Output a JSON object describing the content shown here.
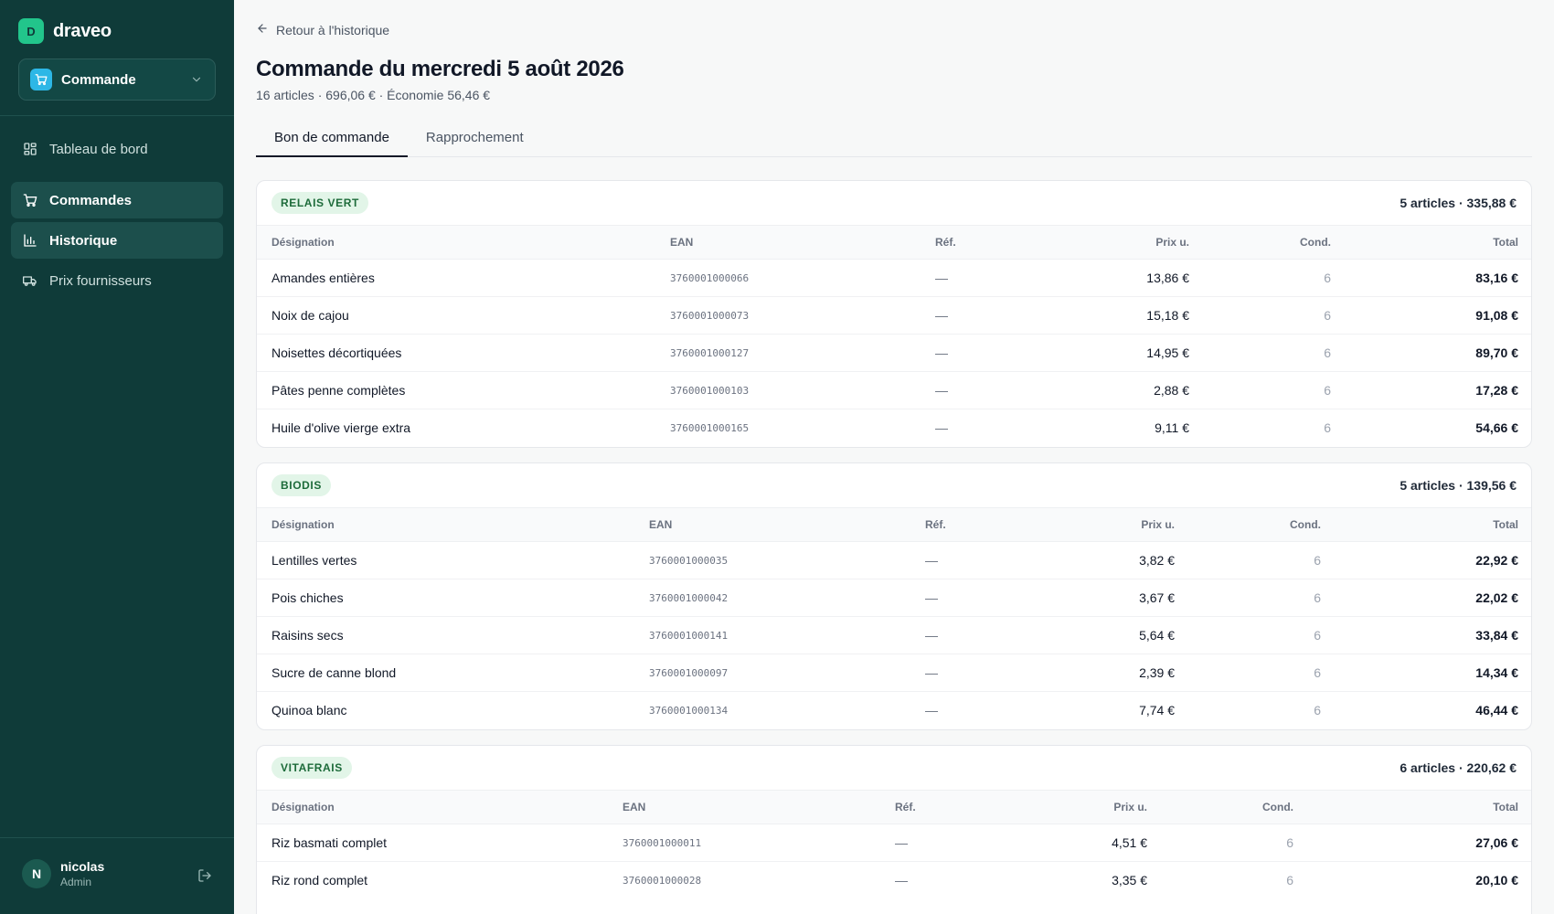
{
  "sidebar": {
    "brand": {
      "mark": "D",
      "name": "draveo"
    },
    "context": {
      "label": "Commande"
    },
    "nav": [
      {
        "label": "Tableau de bord",
        "icon": "dashboard-icon",
        "active": false
      },
      {
        "label": "Commandes",
        "icon": "cart-icon",
        "active": true
      },
      {
        "label": "Historique",
        "icon": "bar-chart-icon",
        "active": true
      },
      {
        "label": "Prix fournisseurs",
        "icon": "truck-icon",
        "active": false
      }
    ],
    "user": {
      "initial": "N",
      "name": "nicolas",
      "role": "Admin"
    }
  },
  "header": {
    "back_label": "Retour à l'historique",
    "title": "Commande du mercredi 5 août 2026",
    "subtitle": "16 articles · 696,06 € · Économie 56,46 €"
  },
  "tabs": [
    {
      "label": "Bon de commande",
      "active": true
    },
    {
      "label": "Rapprochement",
      "active": false
    }
  ],
  "columns": {
    "designation": "Désignation",
    "ean": "EAN",
    "ref": "Réf.",
    "price": "Prix u.",
    "cond": "Cond.",
    "total": "Total"
  },
  "suppliers": [
    {
      "name": "RELAIS VERT",
      "summary": "5 articles · 335,88 €",
      "rows": [
        {
          "designation": "Amandes entières",
          "ean": "3760001000066",
          "ref": "—",
          "price": "13,86 €",
          "cond": "6",
          "total": "83,16 €"
        },
        {
          "designation": "Noix de cajou",
          "ean": "3760001000073",
          "ref": "—",
          "price": "15,18 €",
          "cond": "6",
          "total": "91,08 €"
        },
        {
          "designation": "Noisettes décortiquées",
          "ean": "3760001000127",
          "ref": "—",
          "price": "14,95 €",
          "cond": "6",
          "total": "89,70 €"
        },
        {
          "designation": "Pâtes penne complètes",
          "ean": "3760001000103",
          "ref": "—",
          "price": "2,88 €",
          "cond": "6",
          "total": "17,28 €"
        },
        {
          "designation": "Huile d'olive vierge extra",
          "ean": "3760001000165",
          "ref": "—",
          "price": "9,11 €",
          "cond": "6",
          "total": "54,66 €"
        }
      ]
    },
    {
      "name": "BIODIS",
      "summary": "5 articles · 139,56 €",
      "rows": [
        {
          "designation": "Lentilles vertes",
          "ean": "3760001000035",
          "ref": "—",
          "price": "3,82 €",
          "cond": "6",
          "total": "22,92 €"
        },
        {
          "designation": "Pois chiches",
          "ean": "3760001000042",
          "ref": "—",
          "price": "3,67 €",
          "cond": "6",
          "total": "22,02 €"
        },
        {
          "designation": "Raisins secs",
          "ean": "3760001000141",
          "ref": "—",
          "price": "5,64 €",
          "cond": "6",
          "total": "33,84 €"
        },
        {
          "designation": "Sucre de canne blond",
          "ean": "3760001000097",
          "ref": "—",
          "price": "2,39 €",
          "cond": "6",
          "total": "14,34 €"
        },
        {
          "designation": "Quinoa blanc",
          "ean": "3760001000134",
          "ref": "—",
          "price": "7,74 €",
          "cond": "6",
          "total": "46,44 €"
        }
      ]
    },
    {
      "name": "VITAFRAIS",
      "summary": "6 articles · 220,62 €",
      "rows": [
        {
          "designation": "Riz basmati complet",
          "ean": "3760001000011",
          "ref": "—",
          "price": "4,51 €",
          "cond": "6",
          "total": "27,06 €"
        },
        {
          "designation": "Riz rond complet",
          "ean": "3760001000028",
          "ref": "—",
          "price": "3,35 €",
          "cond": "6",
          "total": "20,10 €"
        }
      ]
    }
  ],
  "colors": {
    "sidebar_bg": "#0f3b39",
    "brand_accent": "#22c58b",
    "context_icon": "#2db7e6",
    "badge_bg": "#e2f5e8",
    "badge_text": "#1d6b3a"
  }
}
